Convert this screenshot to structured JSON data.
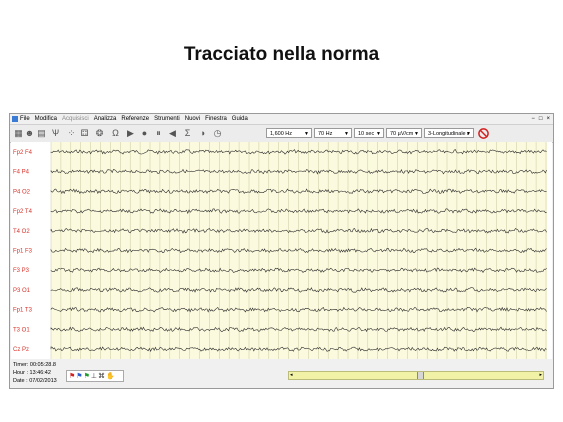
{
  "slide": {
    "title": "Tracciato nella norma"
  },
  "menu": {
    "items": [
      {
        "label": "File",
        "enabled": true
      },
      {
        "label": "Modifica",
        "enabled": true
      },
      {
        "label": "Acquisisci",
        "enabled": false
      },
      {
        "label": "Analizza",
        "enabled": true
      },
      {
        "label": "Referenze",
        "enabled": true
      },
      {
        "label": "Strumenti",
        "enabled": true
      },
      {
        "label": "Nuovi",
        "enabled": true
      },
      {
        "label": "Finestra",
        "enabled": true
      },
      {
        "label": "Guida",
        "enabled": true
      }
    ]
  },
  "window_controls": {
    "minimize": "−",
    "restore": "□",
    "close": "×"
  },
  "toolbar": {
    "icons": [
      "montage-icon",
      "head-icon",
      "book-icon",
      "tree-icon",
      "electrodes-icon",
      "electrode-grid-icon",
      "brain-icon",
      "omega-icon",
      "play-icon",
      "record-icon",
      "pause-icon",
      "back-icon",
      "sigma-icon",
      "head-side-icon",
      "timer-icon"
    ],
    "highpass": "1,600 Hz",
    "lowpass": "70 Hz",
    "timebase": "10 sec",
    "sensitivity": "70 µV/cm",
    "montage": "3-Longitudinale r",
    "no_icon_color": "#d21f1f"
  },
  "eeg": {
    "channels": [
      "Fp2 F4",
      "F4 P4",
      "P4 O2",
      "Fp2 T4",
      "T4 O2",
      "Fp1 F3",
      "F3 P3",
      "P3 O1",
      "Fp1 T3",
      "T3 O1",
      "Cz Pz"
    ],
    "label_color": "#d8342c",
    "background_color": "#fbfade",
    "grid_color": "#c8c8a0",
    "trace_color": "#2a2a2a"
  },
  "status": {
    "timer": "Timer: 00:05:28.8",
    "hour": "Hour   : 13:46:42",
    "date": "Date   : 07/02/2013"
  },
  "flags": [
    "red-flag-icon",
    "blue-flag-icon",
    "green-flag-icon",
    "marker-icon",
    "chip-icon",
    "hand-icon"
  ]
}
